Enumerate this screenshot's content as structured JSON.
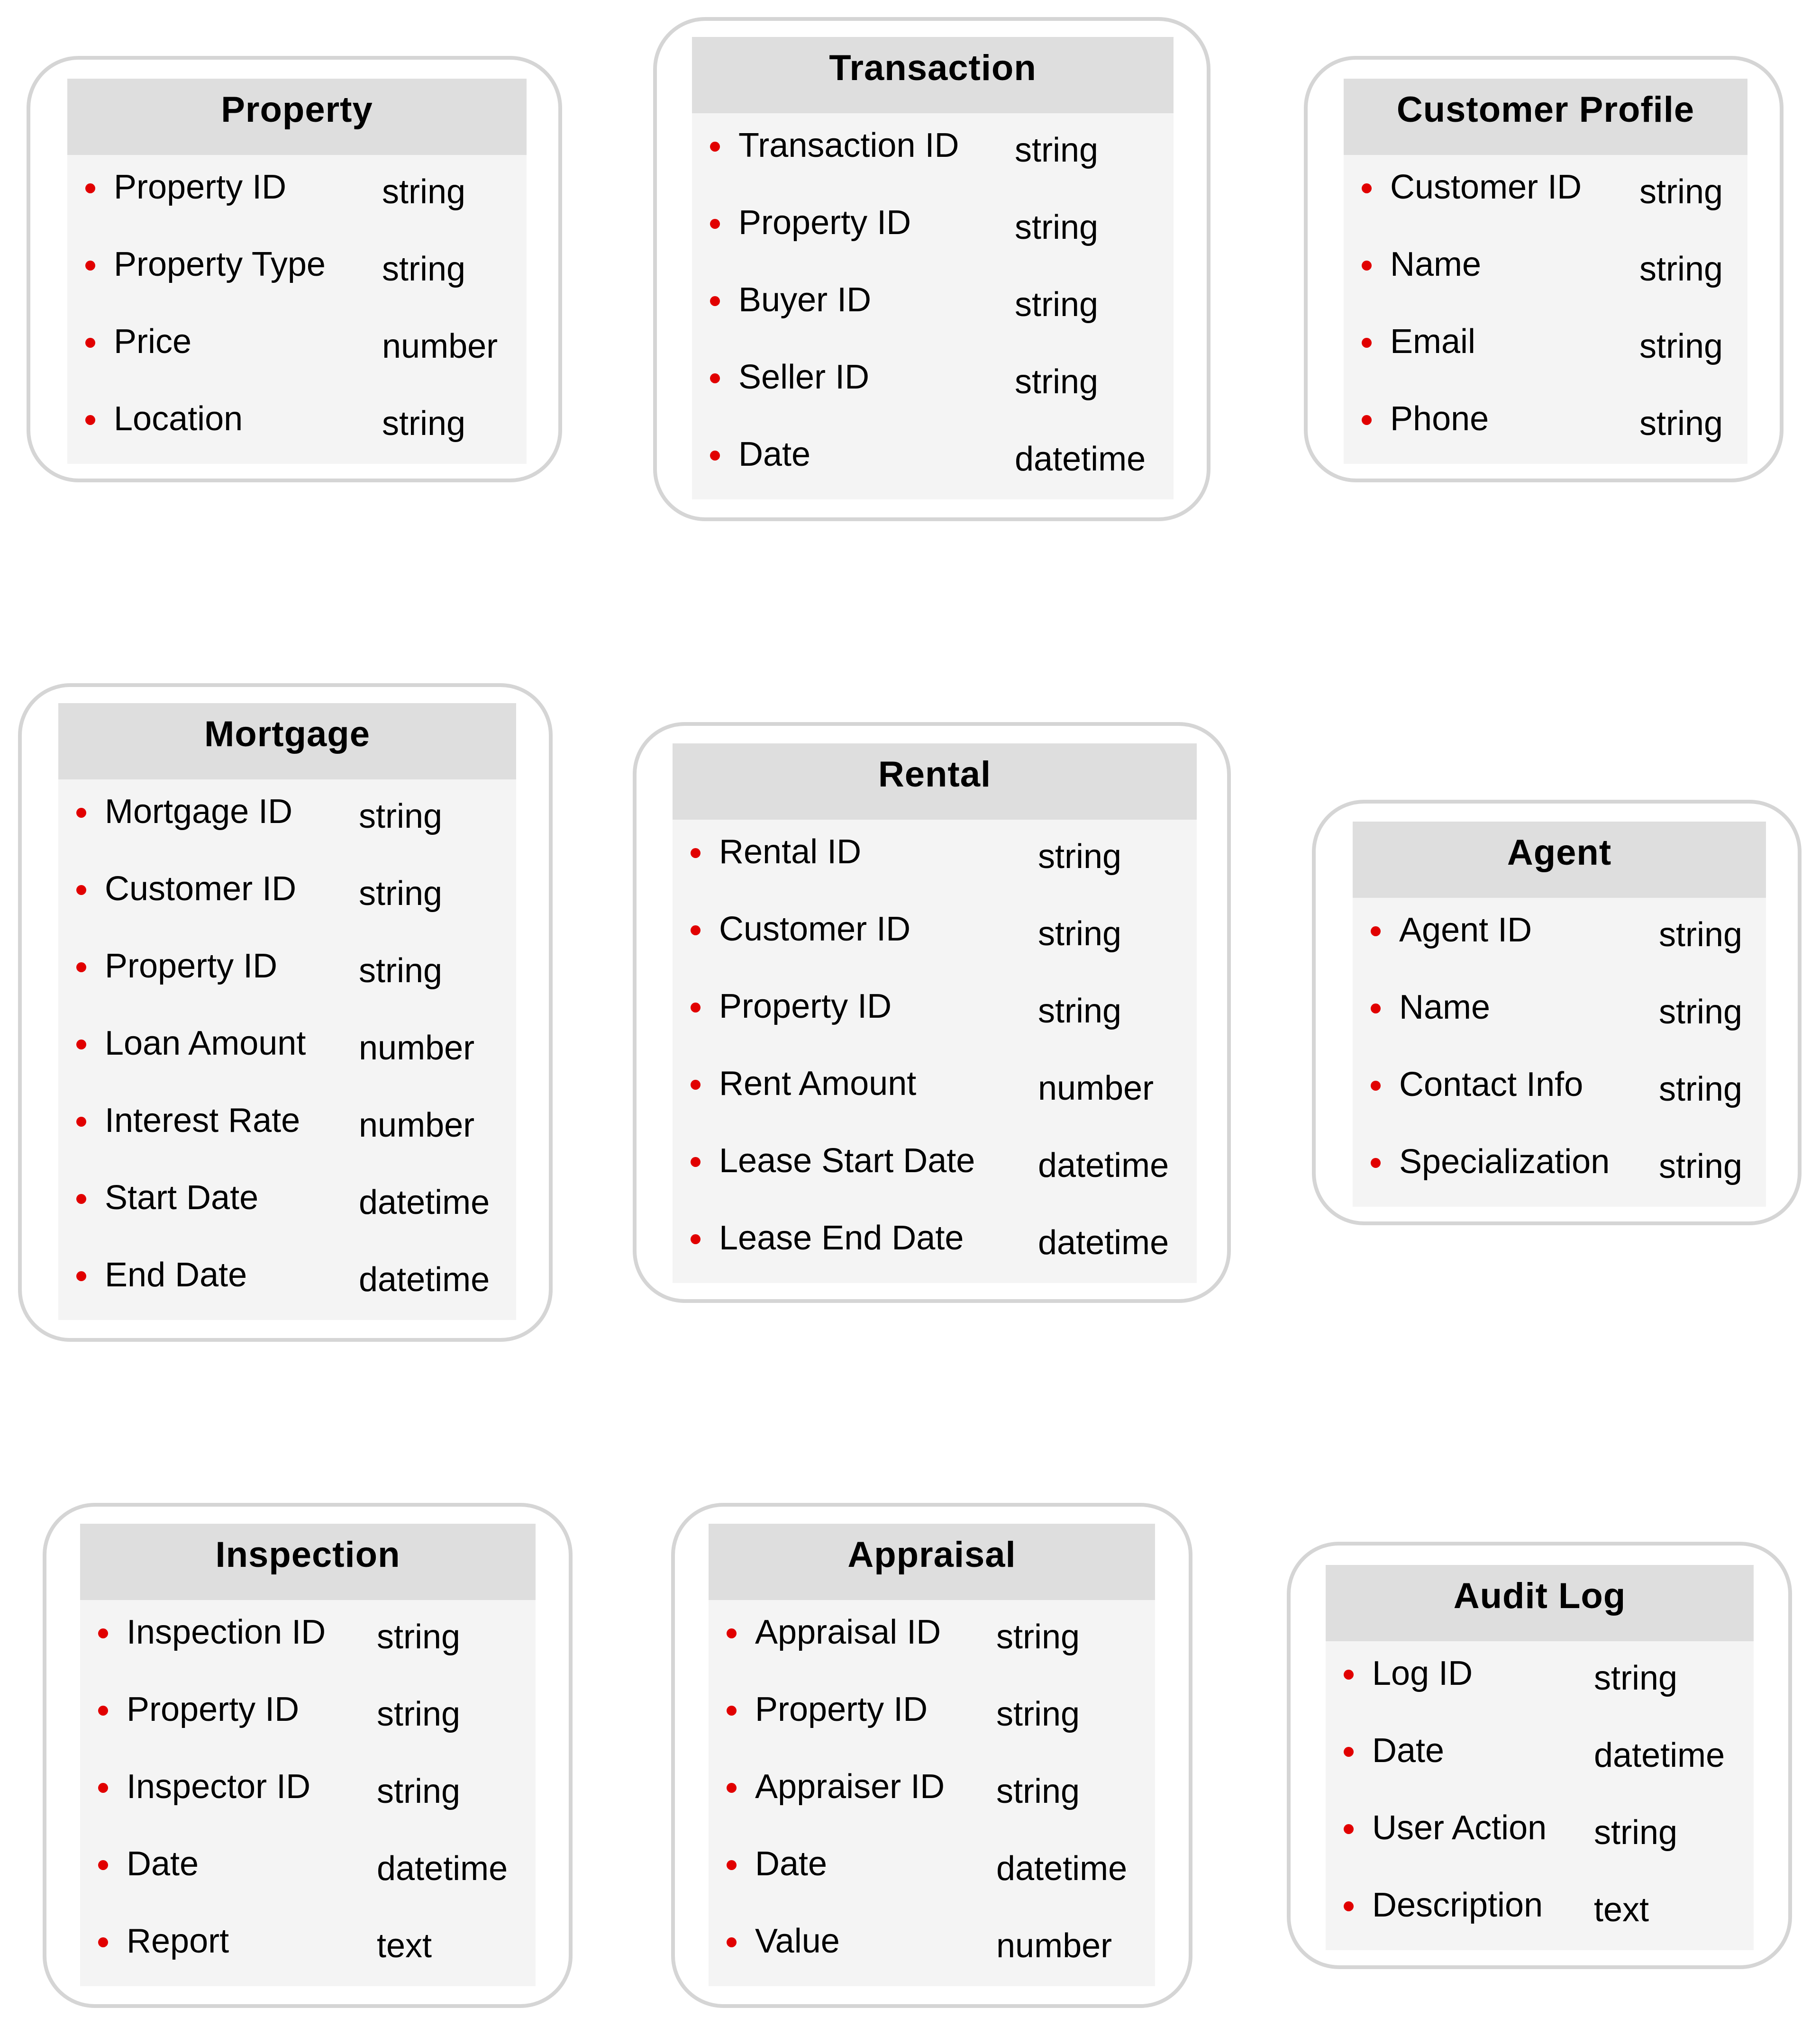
{
  "diagram": {
    "type": "entity-schema",
    "accent_colors": {
      "bullet": "#e10000",
      "header_bg": "#dedede",
      "body_bg": "#f4f4f4",
      "border": "#d5d5d5"
    },
    "entities": {
      "property": {
        "title": "Property",
        "fields": [
          {
            "name": "Property ID",
            "type": "string"
          },
          {
            "name": "Property Type",
            "type": "string"
          },
          {
            "name": "Price",
            "type": "number"
          },
          {
            "name": "Location",
            "type": "string"
          }
        ]
      },
      "transaction": {
        "title": "Transaction",
        "fields": [
          {
            "name": "Transaction ID",
            "type": "string"
          },
          {
            "name": "Property ID",
            "type": "string"
          },
          {
            "name": "Buyer ID",
            "type": "string"
          },
          {
            "name": "Seller ID",
            "type": "string"
          },
          {
            "name": "Date",
            "type": "datetime"
          }
        ]
      },
      "customer": {
        "title": "Customer Profile",
        "fields": [
          {
            "name": "Customer ID",
            "type": "string"
          },
          {
            "name": "Name",
            "type": "string"
          },
          {
            "name": "Email",
            "type": "string"
          },
          {
            "name": "Phone",
            "type": "string"
          }
        ]
      },
      "mortgage": {
        "title": "Mortgage",
        "fields": [
          {
            "name": "Mortgage ID",
            "type": "string"
          },
          {
            "name": "Customer ID",
            "type": "string"
          },
          {
            "name": "Property ID",
            "type": "string"
          },
          {
            "name": "Loan Amount",
            "type": "number"
          },
          {
            "name": "Interest Rate",
            "type": "number"
          },
          {
            "name": "Start Date",
            "type": "datetime"
          },
          {
            "name": "End Date",
            "type": "datetime"
          }
        ]
      },
      "rental": {
        "title": "Rental",
        "fields": [
          {
            "name": "Rental ID",
            "type": "string"
          },
          {
            "name": "Customer ID",
            "type": "string"
          },
          {
            "name": "Property ID",
            "type": "string"
          },
          {
            "name": "Rent Amount",
            "type": "number"
          },
          {
            "name": "Lease Start Date",
            "type": "datetime"
          },
          {
            "name": "Lease End Date",
            "type": "datetime"
          }
        ]
      },
      "agent": {
        "title": "Agent",
        "fields": [
          {
            "name": "Agent ID",
            "type": "string"
          },
          {
            "name": "Name",
            "type": "string"
          },
          {
            "name": "Contact Info",
            "type": "string"
          },
          {
            "name": "Specialization",
            "type": "string"
          }
        ]
      },
      "inspection": {
        "title": "Inspection",
        "fields": [
          {
            "name": "Inspection ID",
            "type": "string"
          },
          {
            "name": "Property ID",
            "type": "string"
          },
          {
            "name": "Inspector ID",
            "type": "string"
          },
          {
            "name": "Date",
            "type": "datetime"
          },
          {
            "name": "Report",
            "type": "text"
          }
        ]
      },
      "appraisal": {
        "title": "Appraisal",
        "fields": [
          {
            "name": "Appraisal ID",
            "type": "string"
          },
          {
            "name": "Property ID",
            "type": "string"
          },
          {
            "name": "Appraiser ID",
            "type": "string"
          },
          {
            "name": "Date",
            "type": "datetime"
          },
          {
            "name": "Value",
            "type": "number"
          }
        ]
      },
      "auditlog": {
        "title": "Audit Log",
        "fields": [
          {
            "name": "Log ID",
            "type": "string"
          },
          {
            "name": "Date",
            "type": "datetime"
          },
          {
            "name": "User Action",
            "type": "string"
          },
          {
            "name": "Description",
            "type": "text"
          }
        ]
      }
    }
  }
}
